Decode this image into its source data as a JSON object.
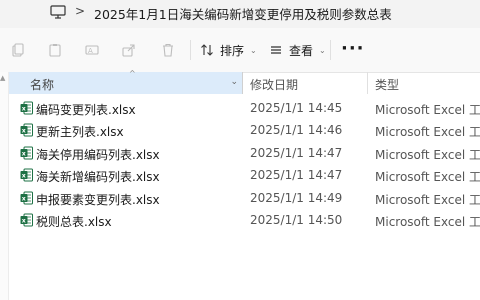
{
  "address_bar": {
    "chevron": ">",
    "path": "2025年1月1日海关编码新增变更停用及税则参数总表"
  },
  "toolbar": {
    "sort_label": "排序",
    "view_label": "查看",
    "more_label": "···"
  },
  "columns": {
    "name": "名称",
    "date": "修改日期",
    "type": "类型",
    "sort_glyph": "^"
  },
  "files": [
    {
      "name": "编码变更列表.xlsx",
      "date": "2025/1/1 14:45",
      "type": "Microsoft Excel 工..."
    },
    {
      "name": "更新主列表.xlsx",
      "date": "2025/1/1 14:46",
      "type": "Microsoft Excel 工..."
    },
    {
      "name": "海关停用编码列表.xlsx",
      "date": "2025/1/1 14:47",
      "type": "Microsoft Excel 工..."
    },
    {
      "name": "海关新增编码列表.xlsx",
      "date": "2025/1/1 14:47",
      "type": "Microsoft Excel 工..."
    },
    {
      "name": "申报要素变更列表.xlsx",
      "date": "2025/1/1 14:49",
      "type": "Microsoft Excel 工..."
    },
    {
      "name": "税则总表.xlsx",
      "date": "2025/1/1 14:50",
      "type": "Microsoft Excel 工..."
    }
  ],
  "colors": {
    "excel_green": "#1d7044",
    "header_selected": "#dcebfa",
    "address_bg": "#f3f3f3"
  },
  "icons": [
    "pc-icon",
    "cut-icon",
    "copy-icon",
    "rename-icon",
    "share-icon",
    "delete-icon",
    "sort-icon",
    "view-icon",
    "excel-file-icon"
  ]
}
